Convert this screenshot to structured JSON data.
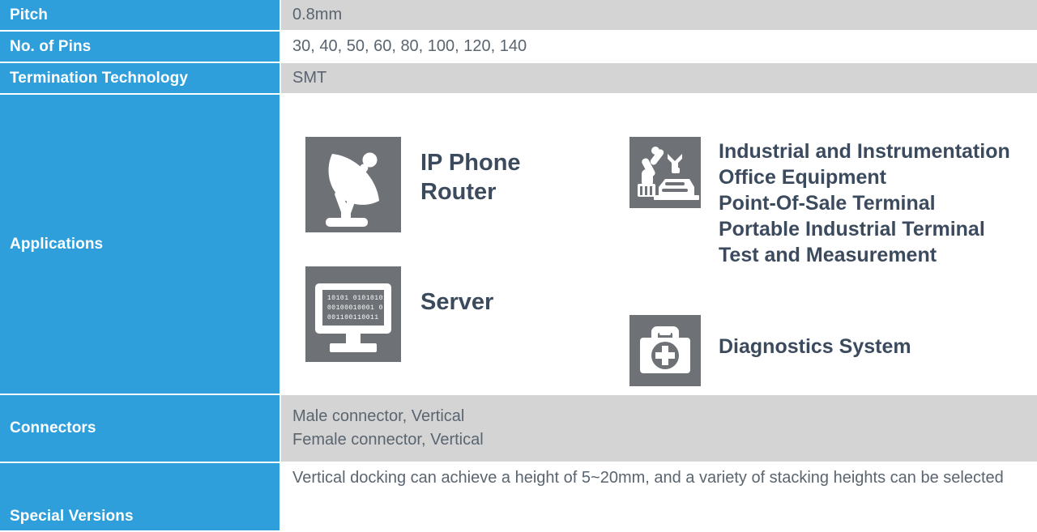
{
  "table": {
    "rows": [
      {
        "label": "Pitch",
        "value": "0.8mm"
      },
      {
        "label": "No. of Pins",
        "value": "30, 40, 50, 60, 80, 100, 120, 140"
      },
      {
        "label": "Termination Technology",
        "value": "SMT"
      },
      {
        "label": "Applications"
      },
      {
        "label": "Connectors",
        "line1": "Male connector, Vertical",
        "line2": "Female connector, Vertical"
      },
      {
        "label": "Special Versions",
        "value": "Vertical docking can achieve a height of 5~20mm, and a variety of stacking heights can be selected"
      }
    ]
  },
  "applications": {
    "satellite": {
      "icon": "satellite-dish-icon",
      "line1": "IP Phone",
      "line2": "Router"
    },
    "server": {
      "icon": "desktop-monitor-binary-icon",
      "line1": "Server"
    },
    "industrial": {
      "icon": "robotic-arm-icon",
      "line1": "Industrial and Instrumentation",
      "line2": "Office Equipment",
      "line3": "Point-Of-Sale Terminal",
      "line4": "Portable Industrial Terminal",
      "line5": "Test and Measurement"
    },
    "diagnostics": {
      "icon": "first-aid-kit-icon",
      "line1": "Diagnostics System"
    }
  },
  "colors": {
    "accent_blue": "#2e9fdb",
    "row_gray": "#d4d4d4",
    "icon_gray": "#6e7276",
    "text_gray": "#5a6570",
    "heading_text": "#3c4a5e"
  }
}
